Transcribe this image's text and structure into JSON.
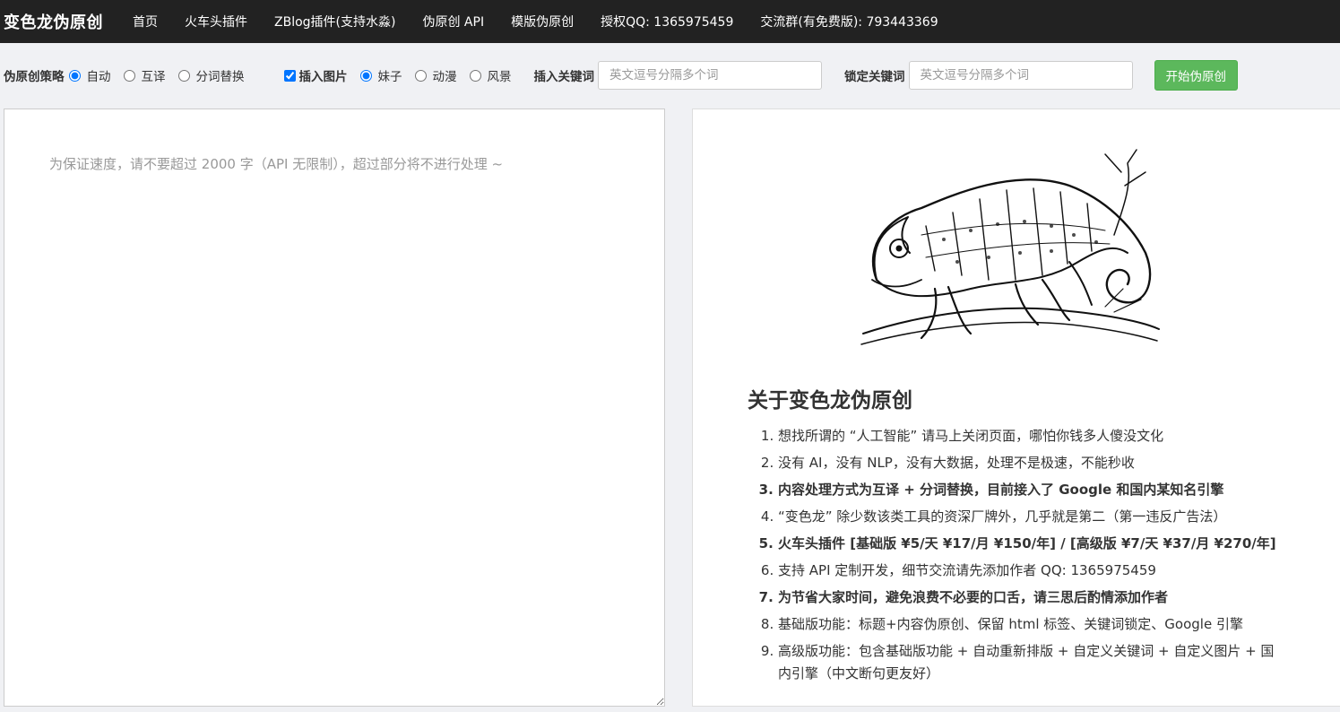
{
  "navbar": {
    "brand": "变色龙伪原创",
    "links": [
      "首页",
      "火车头插件",
      "ZBlog插件(支持水淼)",
      "伪原创 API",
      "模版伪原创",
      "授权QQ: 1365975459",
      "交流群(有免费版): 793443369"
    ]
  },
  "toolbar": {
    "strategy_label": "伪原创策略",
    "strategy_options": [
      "自动",
      "互译",
      "分词替换"
    ],
    "strategy_selected": "自动",
    "insert_image_label": "插入图片",
    "insert_image_checked": true,
    "image_options": [
      "妹子",
      "动漫",
      "风景"
    ],
    "image_selected": "妹子",
    "insert_keywords_label": "插入关键词",
    "insert_keywords_placeholder": "英文逗号分隔多个词",
    "lock_keywords_label": "锁定关键词",
    "lock_keywords_placeholder": "英文逗号分隔多个词",
    "start_button": "开始伪原创"
  },
  "editor": {
    "placeholder": "为保证速度，请不要超过 2000 字（API 无限制），超过部分将不进行处理 ~"
  },
  "about": {
    "illustration": "chameleon-illustration",
    "title": "关于变色龙伪原创",
    "items": [
      {
        "text": "想找所谓的 “人工智能” 请马上关闭页面，哪怕你钱多人傻没文化",
        "bold": false
      },
      {
        "text": "没有 AI，没有 NLP，没有大数据，处理不是极速，不能秒收",
        "bold": false
      },
      {
        "text": "内容处理方式为互译 + 分词替换，目前接入了 Google 和国内某知名引擎",
        "bold": true
      },
      {
        "text": "“变色龙” 除少数该类工具的资深厂牌外，几乎就是第二（第一违反广告法）",
        "bold": false
      },
      {
        "text": "火车头插件 [基础版 ¥5/天 ¥17/月 ¥150/年] / [高级版 ¥7/天 ¥37/月 ¥270/年]",
        "bold": true
      },
      {
        "text": "支持 API 定制开发，细节交流请先添加作者 QQ: 1365975459",
        "bold": false
      },
      {
        "text": "为节省大家时间，避免浪费不必要的口舌，请三思后酌情添加作者",
        "bold": true
      },
      {
        "text": "基础版功能：标题+内容伪原创、保留 html 标签、关键词锁定、Google 引擎",
        "bold": false
      },
      {
        "text": "高级版功能：包含基础版功能 + 自动重新排版 + 自定义关键词 + 自定义图片 + 国内引擎（中文断句更友好）",
        "bold": false
      }
    ]
  },
  "colors": {
    "navbar_bg": "#222222",
    "page_bg": "#f0f1f4",
    "start_button_bg": "#5cb85c",
    "radio_accent": "#1a73e8"
  }
}
